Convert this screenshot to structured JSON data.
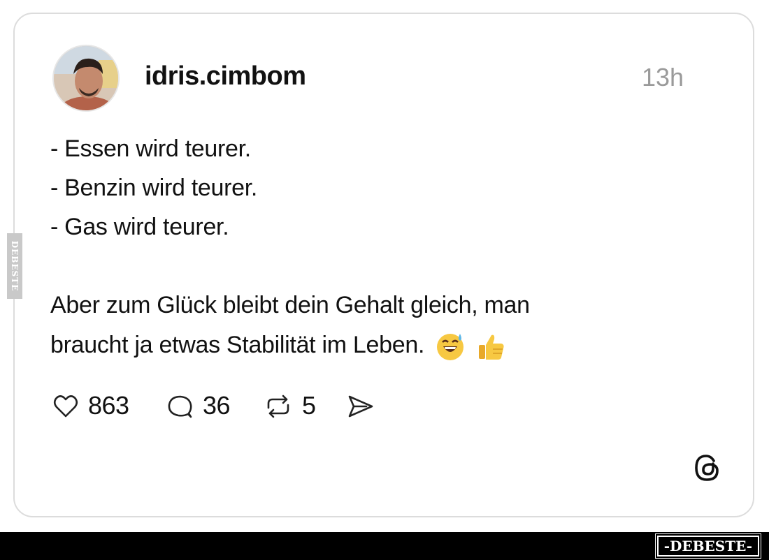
{
  "post": {
    "username": "idris.cimbom",
    "time": "13h",
    "lines": [
      "- Essen wird teurer.",
      "- Benzin wird teurer.",
      "- Gas wird teurer.",
      "Aber zum Glück bleibt dein Gehalt gleich, man",
      "braucht ja etwas Stabilität im Leben."
    ],
    "emojis": [
      "grinning-sweat-emoji",
      "thumbs-up-emoji"
    ]
  },
  "actions": {
    "likes": "863",
    "comments": "36",
    "reposts": "5"
  },
  "icons": {
    "like": "heart-icon",
    "comment": "comment-bubble-icon",
    "repost": "repost-icon",
    "share": "send-icon",
    "app": "threads-logo-icon"
  },
  "watermark": {
    "side": "DEBESTE",
    "footer": "-DEBESTE-"
  },
  "colors": {
    "text": "#111111",
    "muted": "#9a9a9a",
    "border": "#dcdcdc",
    "footer": "#000000"
  }
}
